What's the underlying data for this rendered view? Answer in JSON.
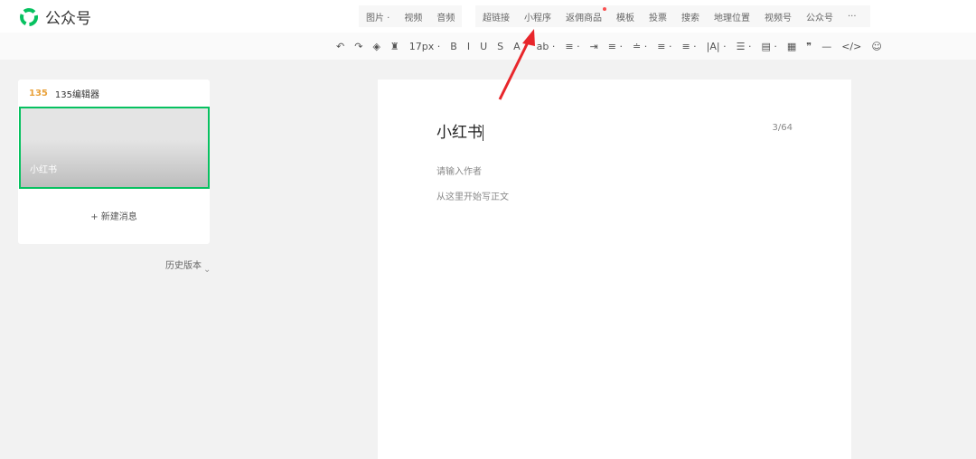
{
  "app": {
    "title": "公众号"
  },
  "media_group": [
    "图片 ·",
    "视频",
    "音频"
  ],
  "insert_group": [
    "超链接",
    "小程序",
    "返佣商品",
    "模板",
    "投票",
    "搜索",
    "地理位置",
    "视频号",
    "公众号",
    "···"
  ],
  "toolbar": [
    "↶",
    "↷",
    "◈",
    "♜",
    "17px ·",
    "B",
    "I",
    "U",
    "S",
    "A ·",
    "ab ·",
    "≡ ·",
    "⇥",
    "≡ ·",
    "≐ ·",
    "≡ ·",
    "≡ ·",
    "|A| ·",
    "☰ ·",
    "▤ ·",
    "▦",
    "❞",
    "—",
    "</>",
    "☺"
  ],
  "sidebar": {
    "account": "135编辑器",
    "article_title": "小红书",
    "new_message": "+ 新建消息",
    "history": "历史版本"
  },
  "editor": {
    "title": "小红书",
    "title_count": "3/64",
    "author_placeholder": "请输入作者",
    "body_placeholder": "从这里开始写正文"
  },
  "colors": {
    "brand": "#07c160",
    "arrow": "#e8262b"
  }
}
